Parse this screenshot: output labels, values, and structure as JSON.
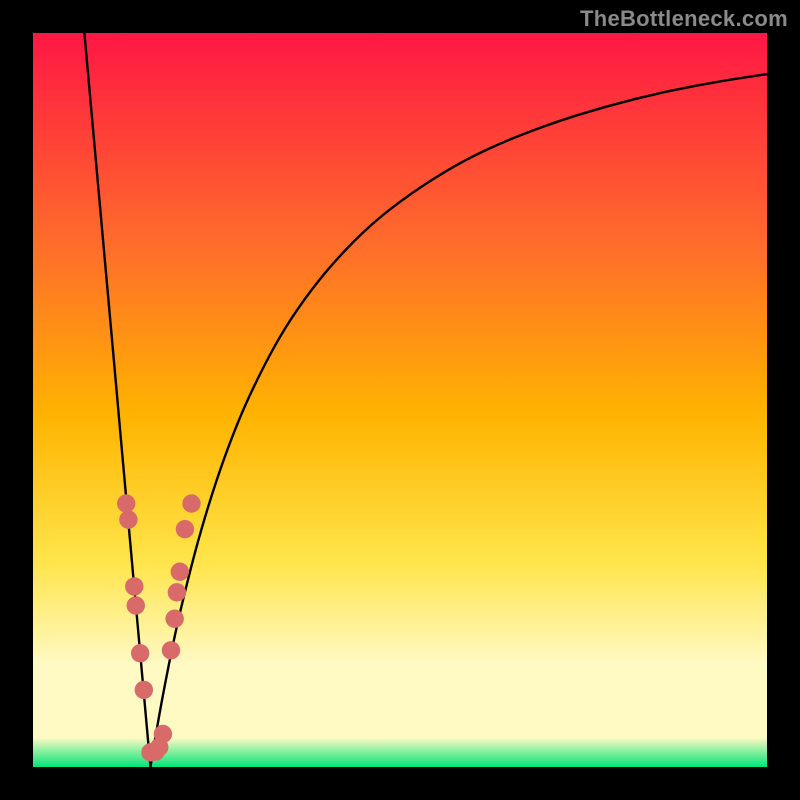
{
  "attribution": "TheBottleneck.com",
  "colors": {
    "frame": "#000000",
    "gradient_top": "#ff1744",
    "gradient_upper_mid": "#ff6a2c",
    "gradient_mid": "#ffb300",
    "gradient_lower_mid": "#ffe54a",
    "gradient_pale": "#fff9c4",
    "gradient_bottom": "#00e676",
    "curve": "#000000",
    "marker_fill": "#d86a6a",
    "marker_stroke": "#bf5a5a"
  },
  "chart_data": {
    "type": "line",
    "title": "",
    "xlabel": "",
    "ylabel": "",
    "x_range": [
      0,
      100
    ],
    "y_range": [
      0,
      100
    ],
    "minimum_x": 16,
    "series": [
      {
        "name": "left-branch",
        "x": [
          7,
          8,
          9,
          10,
          11,
          12,
          13,
          14,
          15,
          16
        ],
        "y": [
          100,
          88.9,
          77.8,
          66.7,
          55.6,
          44.4,
          33.3,
          22.2,
          11.1,
          0
        ]
      },
      {
        "name": "right-branch",
        "x": [
          16,
          17,
          18,
          19,
          20,
          22,
          24,
          26,
          28,
          30,
          33,
          36,
          40,
          45,
          50,
          56,
          62,
          70,
          78,
          86,
          94,
          100
        ],
        "y": [
          0,
          6.0,
          11.4,
          16.4,
          21.0,
          29.1,
          36.0,
          42.0,
          47.2,
          51.7,
          57.6,
          62.4,
          67.7,
          73.0,
          77.1,
          81.1,
          84.3,
          87.5,
          90.0,
          92.0,
          93.5,
          94.4
        ]
      }
    ],
    "markers": [
      {
        "x": 12.7,
        "y": 35.9
      },
      {
        "x": 13.0,
        "y": 33.7
      },
      {
        "x": 13.8,
        "y": 24.6
      },
      {
        "x": 14.0,
        "y": 22.0
      },
      {
        "x": 14.6,
        "y": 15.5
      },
      {
        "x": 15.1,
        "y": 10.5
      },
      {
        "x": 16.0,
        "y": 2.0
      },
      {
        "x": 16.7,
        "y": 2.1
      },
      {
        "x": 17.2,
        "y": 2.7
      },
      {
        "x": 17.7,
        "y": 4.5
      },
      {
        "x": 18.8,
        "y": 15.9
      },
      {
        "x": 19.3,
        "y": 20.2
      },
      {
        "x": 19.6,
        "y": 23.8
      },
      {
        "x": 20.0,
        "y": 26.6
      },
      {
        "x": 20.7,
        "y": 32.4
      },
      {
        "x": 21.6,
        "y": 35.9
      }
    ]
  }
}
